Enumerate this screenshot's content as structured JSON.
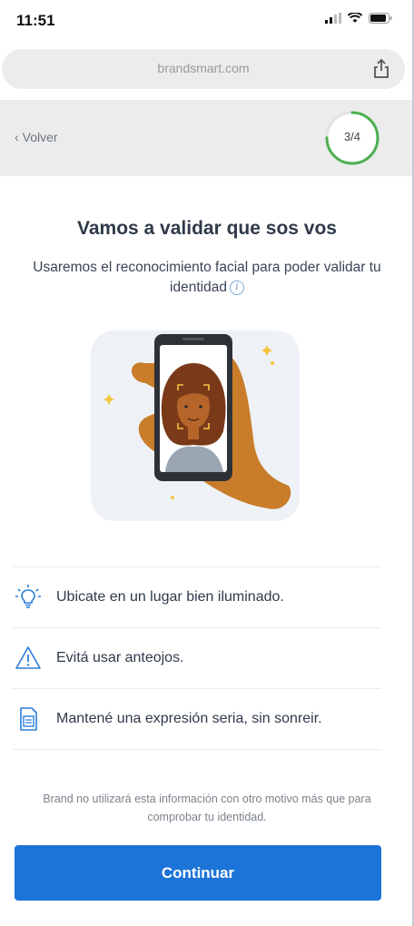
{
  "status_bar": {
    "time": "11:51"
  },
  "browser": {
    "url": "brandsmart.com",
    "share_icon": "share-icon"
  },
  "nav": {
    "back_label": "Volver",
    "step": "3/4",
    "step_progress": 0.75
  },
  "content": {
    "title": "Vamos a validar que sos vos",
    "subtitle": "Usaremos el reconocimiento facial para poder validar tu identidad"
  },
  "tips": [
    {
      "icon": "lightbulb-icon",
      "text": "Ubicate en un lugar bien iluminado."
    },
    {
      "icon": "warning-icon",
      "text": "Evitá usar anteojos."
    },
    {
      "icon": "document-icon",
      "text": "Mantené una expresión seria, sin sonreir."
    }
  ],
  "disclaimer": "Brand no utilizará esta información con otro motivo más que para comprobar tu identidad.",
  "cta": {
    "label": "Continuar"
  },
  "colors": {
    "primary": "#1d74d8",
    "progress": "#4caf50",
    "illustration_hand": "#c97d2a"
  }
}
